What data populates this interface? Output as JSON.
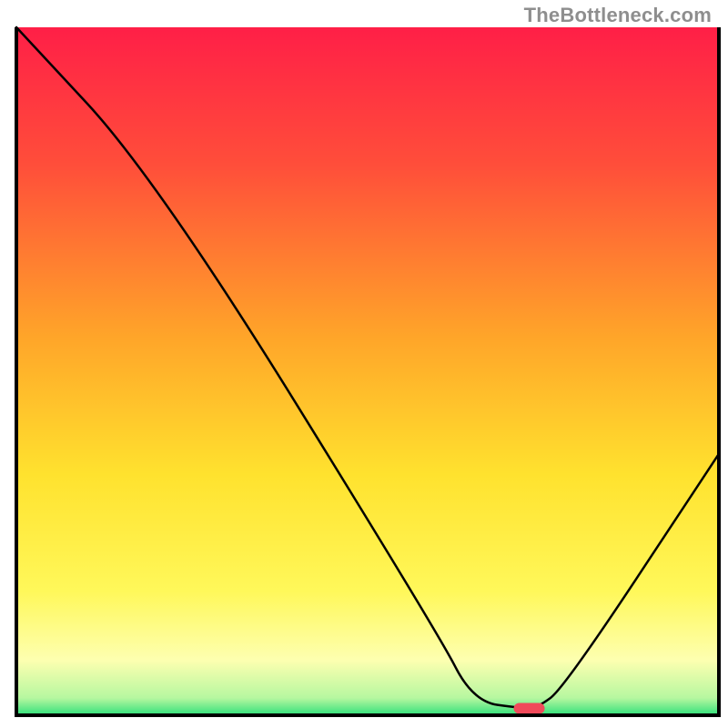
{
  "watermark": "TheBottleneck.com",
  "chart_data": {
    "type": "line",
    "title": "",
    "xlabel": "",
    "ylabel": "",
    "xlim": [
      0,
      100
    ],
    "ylim": [
      0,
      100
    ],
    "series": [
      {
        "name": "bottleneck-curve",
        "x": [
          0,
          20,
          60,
          65,
          72,
          74,
          78,
          100
        ],
        "y": [
          100,
          78,
          12,
          2,
          1,
          1,
          4,
          38
        ]
      }
    ],
    "marker": {
      "x": 73,
      "y": 1,
      "color": "#f04a5a"
    },
    "gradient_stops": [
      {
        "offset": 0.0,
        "color": "#ff1f47"
      },
      {
        "offset": 0.2,
        "color": "#ff4e3a"
      },
      {
        "offset": 0.45,
        "color": "#ffa529"
      },
      {
        "offset": 0.65,
        "color": "#ffe22e"
      },
      {
        "offset": 0.82,
        "color": "#fff85a"
      },
      {
        "offset": 0.92,
        "color": "#fdffb0"
      },
      {
        "offset": 0.975,
        "color": "#b6f7a0"
      },
      {
        "offset": 1.0,
        "color": "#2fe07a"
      }
    ],
    "frame_color": "#000000",
    "frame_width": 4
  }
}
